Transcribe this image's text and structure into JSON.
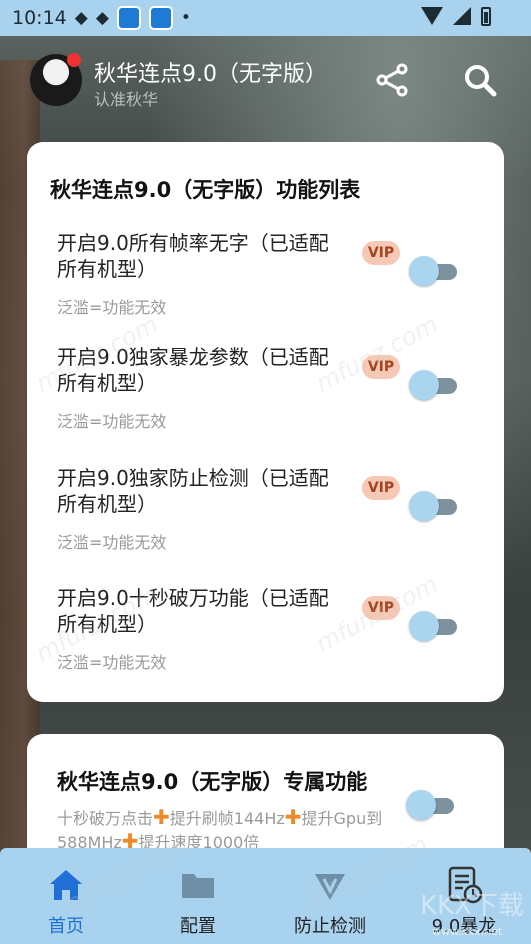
{
  "status_bar": {
    "time": "10:14"
  },
  "header": {
    "title": "秋华连点9.0（无字版）",
    "subtitle": "认准秋华"
  },
  "feature_card": {
    "title": "秋华连点9.0（无字版）功能列表",
    "items": [
      {
        "label": "开启9.0所有帧率无字（已适配所有机型）",
        "badge": "VIP",
        "desc": "泛滥=功能无效"
      },
      {
        "label": "开启9.0独家暴龙参数（已适配所有机型）",
        "badge": "VIP",
        "desc": "泛滥=功能无效"
      },
      {
        "label": "开启9.0独家防止检测（已适配所有机型）",
        "badge": "VIP",
        "desc": "泛滥=功能无效"
      },
      {
        "label": "开启9.0十秒破万功能（已适配所有机型）",
        "badge": "VIP",
        "desc": "泛滥=功能无效"
      }
    ]
  },
  "exclusive_card": {
    "title": "秋华连点9.0（无字版）专属功能",
    "desc_parts": [
      "十秒破万点击",
      "提升刷帧144Hz",
      "提升Gpu到588MHz",
      "提升速度1000倍"
    ]
  },
  "bottom_nav": [
    {
      "label": "首页",
      "icon": "home-icon",
      "active": true
    },
    {
      "label": "配置",
      "icon": "folder-icon",
      "active": false
    },
    {
      "label": "防止检测",
      "icon": "v-shield-icon",
      "active": false
    },
    {
      "label": "9.0暴龙",
      "icon": "document-clock-icon",
      "active": false
    }
  ],
  "watermarks": [
    "mfunz.com",
    "KKX下载",
    "www.kkx.net"
  ],
  "colors": {
    "accent": "#a9d2ef",
    "active_nav": "#1f6fd6",
    "vip_bg": "#f6c9b6",
    "plus": "#ef8a2b"
  }
}
